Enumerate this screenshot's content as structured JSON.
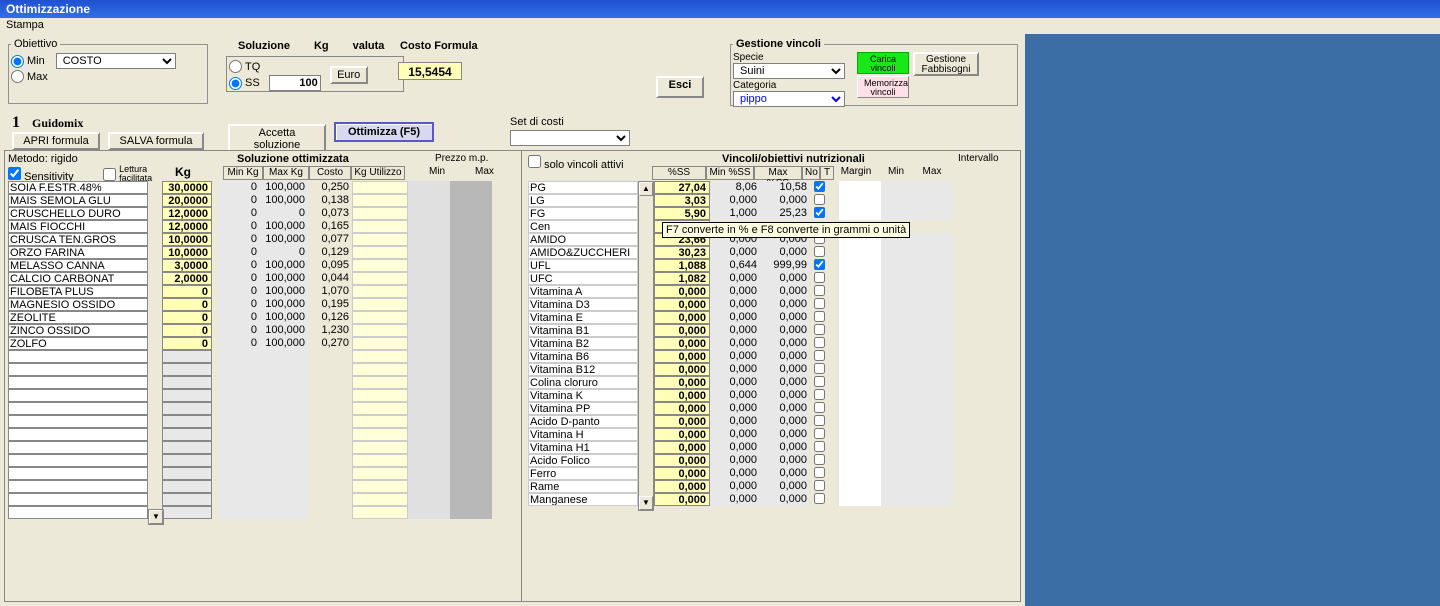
{
  "title": "Ottimizzazione",
  "menu": {
    "stampa": "Stampa"
  },
  "obj": {
    "legend": "Obiettivo",
    "min": "Min",
    "max": "Max",
    "select": "COSTO"
  },
  "sol": {
    "legend": "Soluzione",
    "kg": "Kg",
    "valuta": "valuta",
    "tq": "TQ",
    "ss": "SS",
    "kg_val": "100",
    "btn_euro": "Euro"
  },
  "costo": {
    "legend": "Costo Formula",
    "val": "15,5454"
  },
  "set_costi": {
    "label": "Set di costi",
    "val": ""
  },
  "btn": {
    "esci": "Esci",
    "accetta": "Accetta soluzione",
    "ottimizza": "Ottimizza (F5)",
    "apri": "APRI formula",
    "salva": "SALVA formula"
  },
  "big1": "1",
  "guidomix": "Guidomix",
  "vinc": {
    "legend": "Gestione vincoli",
    "specie": "Specie",
    "specie_val": "Suini",
    "categoria": "Categoria",
    "categoria_val": "pippo",
    "carica": "Carica vincoli",
    "gest_fabb": "Gestione Fabbisogni",
    "memorizza": "Memorizza vincoli"
  },
  "left": {
    "metodo": "Metodo: rigido",
    "sensitivity": "Sensitivity",
    "lettura": "Lettura facilitata",
    "sol_ott": "Soluzione ottimizzata",
    "kg": "Kg",
    "minkg": "Min Kg",
    "maxkg": "Max Kg",
    "costo": "Costo",
    "kgutil": "Kg Utilizzo",
    "prezzo": "Prezzo m.p.",
    "min": "Min",
    "max": "Max"
  },
  "ingredients": [
    {
      "name": "SOIA F.ESTR.48%",
      "kg": "30,0000",
      "min": "0",
      "max": "100,000",
      "cost": "0,250"
    },
    {
      "name": "MAIS SEMOLA GLU",
      "kg": "20,0000",
      "min": "0",
      "max": "100,000",
      "cost": "0,138"
    },
    {
      "name": "CRUSCHELLO DURO",
      "kg": "12,0000",
      "min": "0",
      "max": "0",
      "cost": "0,073"
    },
    {
      "name": "MAIS FIOCCHI",
      "kg": "12,0000",
      "min": "0",
      "max": "100,000",
      "cost": "0,165"
    },
    {
      "name": "CRUSCA TEN.GROS",
      "kg": "10,0000",
      "min": "0",
      "max": "100,000",
      "cost": "0,077"
    },
    {
      "name": "ORZO FARINA",
      "kg": "10,0000",
      "min": "0",
      "max": "0",
      "cost": "0,129"
    },
    {
      "name": "MELASSO CANNA",
      "kg": "3,0000",
      "min": "0",
      "max": "100,000",
      "cost": "0,095"
    },
    {
      "name": "CALCIO CARBONAT",
      "kg": "2,0000",
      "min": "0",
      "max": "100,000",
      "cost": "0,044"
    },
    {
      "name": "FILOBETA PLUS",
      "kg": "0",
      "min": "0",
      "max": "100,000",
      "cost": "1,070"
    },
    {
      "name": "MAGNESIO OSSIDO",
      "kg": "0",
      "min": "0",
      "max": "100,000",
      "cost": "0,195"
    },
    {
      "name": "ZEOLITE",
      "kg": "0",
      "min": "0",
      "max": "100,000",
      "cost": "0,126"
    },
    {
      "name": "ZINCO OSSIDO",
      "kg": "0",
      "min": "0",
      "max": "100,000",
      "cost": "1,230"
    },
    {
      "name": "ZOLFO",
      "kg": "0",
      "min": "0",
      "max": "100,000",
      "cost": "0,270"
    }
  ],
  "empty_rows": 13,
  "right": {
    "solo": "solo vincoli attivi",
    "title": "Vincoli/obiettivi nutrizionali",
    "ss": "%SS",
    "minss": "Min %SS",
    "maxss": "Max %SS",
    "no": "No",
    "t": "T",
    "margin": "Margin",
    "intervallo": "Intervallo",
    "min": "Min",
    "max": "Max"
  },
  "tooltip": "F7 converte in % e F8 converte in grammi o unità",
  "nutrients": [
    {
      "name": "PG",
      "ss": "27,04",
      "min": "8,06",
      "max": "10,58",
      "chk": true
    },
    {
      "name": "LG",
      "ss": "3,03",
      "min": "0,000",
      "max": "0,000",
      "chk": false
    },
    {
      "name": "FG",
      "ss": "5,90",
      "min": "1,000",
      "max": "25,23",
      "chk": true
    },
    {
      "name": "Cen",
      "ss": "",
      "min": "",
      "max": "",
      "chk": false,
      "tooltip": true
    },
    {
      "name": "AMIDO",
      "ss": "23,66",
      "min": "0,000",
      "max": "0,000",
      "chk": false
    },
    {
      "name": "AMIDO&ZUCCHERI",
      "ss": "30,23",
      "min": "0,000",
      "max": "0,000",
      "chk": false
    },
    {
      "name": "UFL",
      "ss": "1,088",
      "min": "0,644",
      "max": "999,99",
      "chk": true
    },
    {
      "name": "UFC",
      "ss": "1,082",
      "min": "0,000",
      "max": "0,000",
      "chk": false
    },
    {
      "name": "Vitamina A",
      "ss": "0,000",
      "min": "0,000",
      "max": "0,000",
      "chk": false
    },
    {
      "name": "Vitamina D3",
      "ss": "0,000",
      "min": "0,000",
      "max": "0,000",
      "chk": false
    },
    {
      "name": "Vitamina E",
      "ss": "0,000",
      "min": "0,000",
      "max": "0,000",
      "chk": false
    },
    {
      "name": "Vitamina B1",
      "ss": "0,000",
      "min": "0,000",
      "max": "0,000",
      "chk": false
    },
    {
      "name": "Vitamina B2",
      "ss": "0,000",
      "min": "0,000",
      "max": "0,000",
      "chk": false
    },
    {
      "name": "Vitamina B6",
      "ss": "0,000",
      "min": "0,000",
      "max": "0,000",
      "chk": false
    },
    {
      "name": "Vitamina B12",
      "ss": "0,000",
      "min": "0,000",
      "max": "0,000",
      "chk": false
    },
    {
      "name": "Colina cloruro",
      "ss": "0,000",
      "min": "0,000",
      "max": "0,000",
      "chk": false
    },
    {
      "name": "Vitamina K",
      "ss": "0,000",
      "min": "0,000",
      "max": "0,000",
      "chk": false
    },
    {
      "name": "Vitamina PP",
      "ss": "0,000",
      "min": "0,000",
      "max": "0,000",
      "chk": false
    },
    {
      "name": "Acido D-panto",
      "ss": "0,000",
      "min": "0,000",
      "max": "0,000",
      "chk": false
    },
    {
      "name": "Vitamina H",
      "ss": "0,000",
      "min": "0,000",
      "max": "0,000",
      "chk": false
    },
    {
      "name": "Vitamina H1",
      "ss": "0,000",
      "min": "0,000",
      "max": "0,000",
      "chk": false
    },
    {
      "name": "Acido Folico",
      "ss": "0,000",
      "min": "0,000",
      "max": "0,000",
      "chk": false
    },
    {
      "name": "Ferro",
      "ss": "0,000",
      "min": "0,000",
      "max": "0,000",
      "chk": false
    },
    {
      "name": "Rame",
      "ss": "0,000",
      "min": "0,000",
      "max": "0,000",
      "chk": false
    },
    {
      "name": "Manganese",
      "ss": "0,000",
      "min": "0,000",
      "max": "0,000",
      "chk": false
    }
  ]
}
